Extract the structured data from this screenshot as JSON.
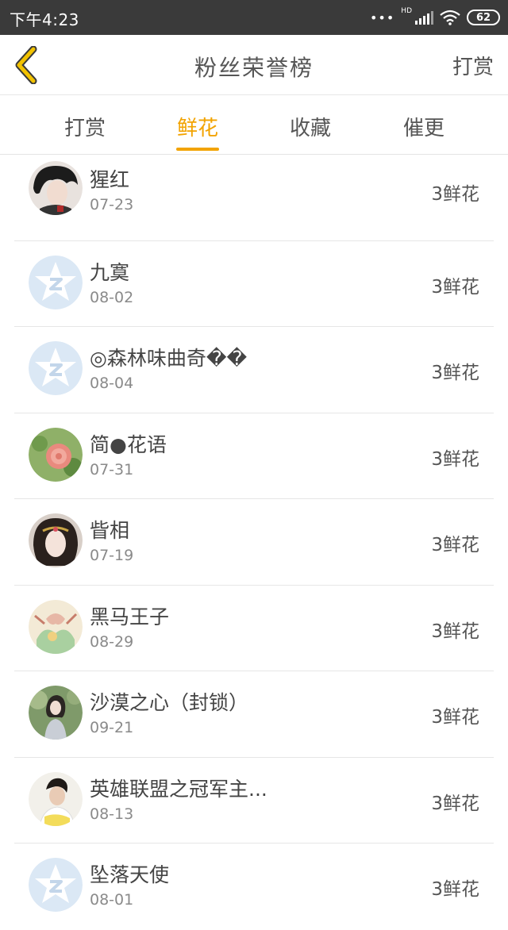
{
  "status_bar": {
    "time": "下午4:23",
    "signal_label": "HD",
    "battery": "62"
  },
  "header": {
    "title": "粉丝荣誉榜",
    "action_label": "打赏"
  },
  "tabs": [
    {
      "label": "打赏",
      "active": false
    },
    {
      "label": "鲜花",
      "active": true
    },
    {
      "label": "收藏",
      "active": false
    },
    {
      "label": "催更",
      "active": false
    }
  ],
  "accent_color": "#f2a300",
  "fans": [
    {
      "name": "猩红",
      "date": "07-23",
      "count": "3鲜花",
      "avatar": "dark-hair-avatar"
    },
    {
      "name": "九寞",
      "date": "08-02",
      "count": "3鲜花",
      "avatar": "default-star-avatar"
    },
    {
      "name": "◎森林味曲奇��",
      "date": "08-04",
      "count": "3鲜花",
      "avatar": "default-star-avatar"
    },
    {
      "name": "简●花语",
      "date": "07-31",
      "count": "3鲜花",
      "avatar": "flower-avatar"
    },
    {
      "name": "眥相",
      "date": "07-19",
      "count": "3鲜花",
      "avatar": "ancient-lady-avatar"
    },
    {
      "name": "黑马王子",
      "date": "08-29",
      "count": "3鲜花",
      "avatar": "illustration-avatar"
    },
    {
      "name": "沙漠之心（封锁）",
      "date": "09-21",
      "count": "3鲜花",
      "avatar": "girl-photo-avatar"
    },
    {
      "name": "英雄联盟之冠军主...",
      "date": "08-13",
      "count": "3鲜花",
      "avatar": "young-man-avatar"
    },
    {
      "name": "坠落天使",
      "date": "08-01",
      "count": "3鲜花",
      "avatar": "default-star-avatar"
    }
  ]
}
